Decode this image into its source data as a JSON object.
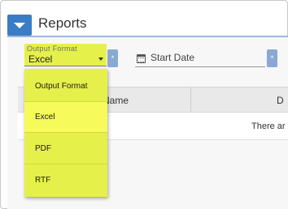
{
  "header": {
    "title": "Reports"
  },
  "filters": {
    "output_format_label": "Output Format",
    "output_format_value": "Excel",
    "start_date_label": "Start Date",
    "required_marker": "*"
  },
  "table": {
    "columns": [
      "Name",
      "D"
    ],
    "empty_message": "There ar"
  },
  "dropdown": {
    "items": [
      "Output Format",
      "Excel",
      "PDF",
      "RTF"
    ],
    "highlighted": "Excel"
  },
  "colors": {
    "accent": "#3a7cc5",
    "highlight": "#e6f04a"
  }
}
